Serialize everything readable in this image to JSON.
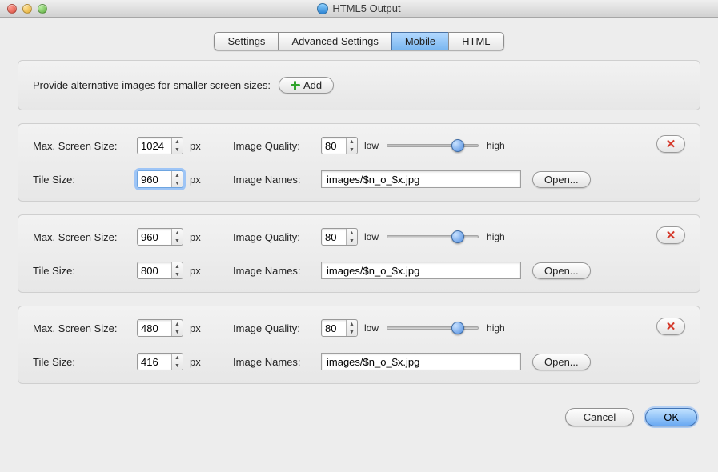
{
  "window": {
    "title": "HTML5 Output"
  },
  "tabs": [
    "Settings",
    "Advanced Settings",
    "Mobile",
    "HTML"
  ],
  "activeTab": "Mobile",
  "header": {
    "label": "Provide alternative images for smaller screen sizes:",
    "addButton": "Add"
  },
  "labels": {
    "maxScreenSize": "Max. Screen Size:",
    "tileSize": "Tile Size:",
    "imageQuality": "Image Quality:",
    "imageNames": "Image Names:",
    "unit": "px",
    "low": "low",
    "high": "high",
    "open": "Open...",
    "cancel": "Cancel",
    "ok": "OK"
  },
  "entries": [
    {
      "maxScreenSize": "1024",
      "tileSize": "960",
      "tileFocused": true,
      "quality": "80",
      "sliderPct": 78,
      "imageNames": "images/$n_o_$x.jpg"
    },
    {
      "maxScreenSize": "960",
      "tileSize": "800",
      "tileFocused": false,
      "quality": "80",
      "sliderPct": 78,
      "imageNames": "images/$n_o_$x.jpg"
    },
    {
      "maxScreenSize": "480",
      "tileSize": "416",
      "tileFocused": false,
      "quality": "80",
      "sliderPct": 78,
      "imageNames": "images/$n_o_$x.jpg"
    }
  ]
}
